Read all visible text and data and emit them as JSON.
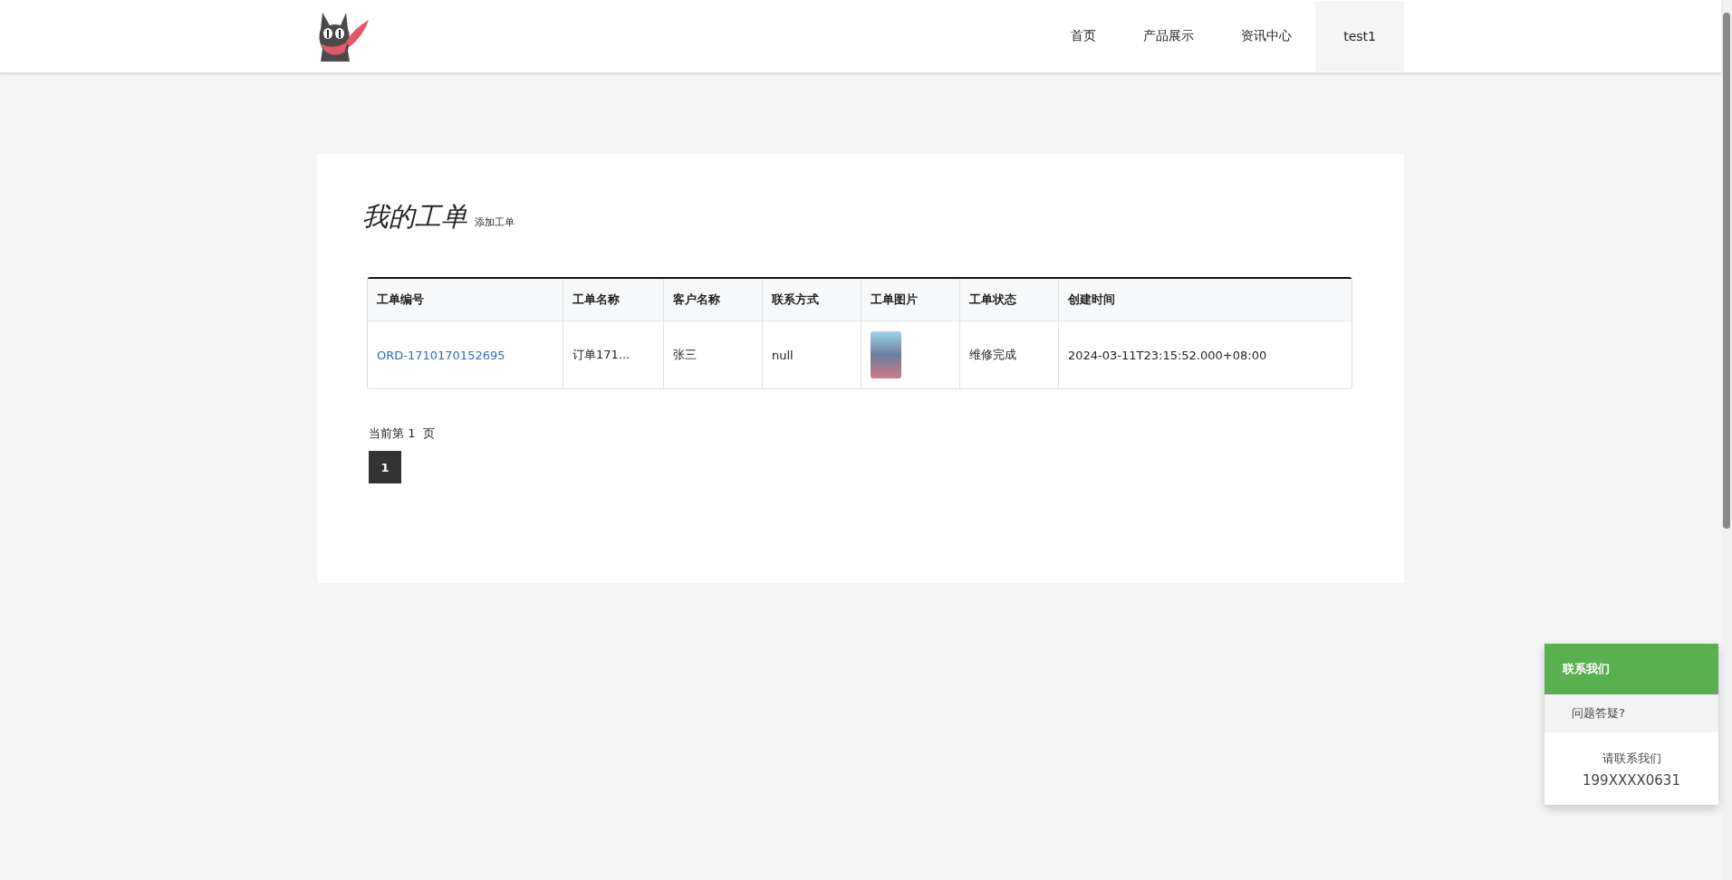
{
  "header": {
    "nav": [
      {
        "label": "首页",
        "selected": false
      },
      {
        "label": "产品展示",
        "selected": false
      },
      {
        "label": "资讯中心",
        "selected": false
      },
      {
        "label": "test1",
        "selected": true
      }
    ]
  },
  "orders": {
    "title": "我的工单",
    "add_link": "添加工单",
    "table": {
      "columns": [
        "工单编号",
        "工单名称",
        "客户名称",
        "联系方式",
        "工单图片",
        "工单状态",
        "创建时间"
      ],
      "rows": [
        {
          "order_no": "ORD-1710170152695",
          "name": "订单171...",
          "customer": "张三",
          "contact": "null",
          "status": "维修完成",
          "created": "2024-03-11T23:15:52.000+08:00"
        }
      ]
    },
    "pagination": {
      "text": "当前第 1  页",
      "pages": [
        {
          "label": "1",
          "selected": true
        }
      ]
    }
  },
  "contact": {
    "title": "联系我们",
    "question": "问题答疑?",
    "prompt": "请联系我们",
    "phone": "199XXXX0631"
  }
}
